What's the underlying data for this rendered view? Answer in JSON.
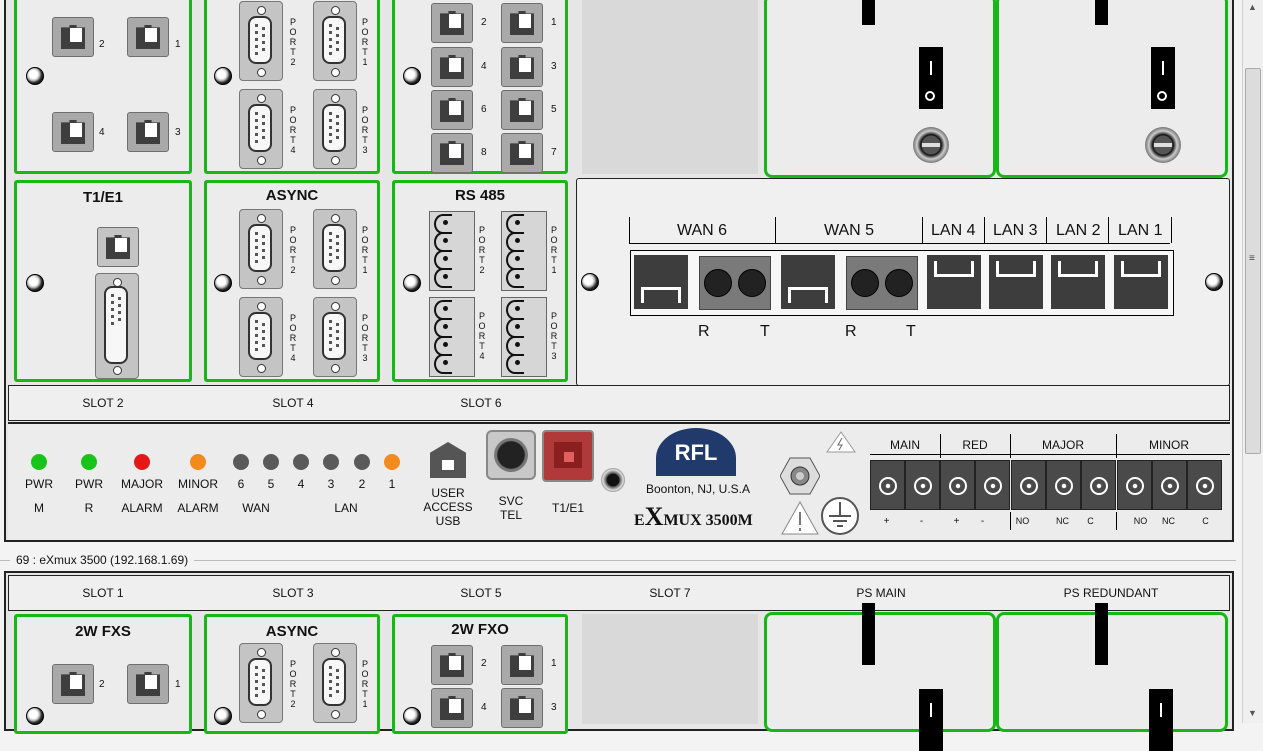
{
  "top_unit": {
    "slot1_ports": [
      "2",
      "1",
      "4",
      "3"
    ],
    "slot3_ports": [
      "PORT2",
      "PORT1",
      "PORT4",
      "PORT3"
    ],
    "slot5_ports": [
      "2",
      "1",
      "4",
      "3",
      "6",
      "5",
      "8",
      "7"
    ],
    "slot2_title": "T1/E1",
    "slot4_title": "ASYNC",
    "slot4_ports": [
      "PORT2",
      "PORT1",
      "PORT4",
      "PORT3"
    ],
    "slot6_title": "RS 485",
    "slot6_ports": [
      "PORT2",
      "PORT1",
      "PORT4",
      "PORT3"
    ],
    "wan_labels": [
      "WAN 6",
      "WAN 5",
      "LAN 4",
      "LAN 3",
      "LAN 2",
      "LAN 1"
    ],
    "rt_labels": [
      "R",
      "T",
      "R",
      "T"
    ],
    "slot_labels": [
      "SLOT 2",
      "SLOT 4",
      "SLOT 6"
    ],
    "front_panel": {
      "leds": [
        {
          "top": "PWR",
          "bottom": "M",
          "color": "#19c419"
        },
        {
          "top": "PWR",
          "bottom": "R",
          "color": "#19c419"
        },
        {
          "top": "MAJOR",
          "bottom": "ALARM",
          "color": "#e51818"
        },
        {
          "top": "MINOR",
          "bottom": "ALARM",
          "color": "#f28a1c"
        }
      ],
      "port_leds": [
        {
          "num": "6",
          "color": "#5a5a5a"
        },
        {
          "num": "5",
          "color": "#5a5a5a"
        },
        {
          "num": "4",
          "color": "#5a5a5a"
        },
        {
          "num": "3",
          "color": "#5a5a5a"
        },
        {
          "num": "2",
          "color": "#5a5a5a"
        },
        {
          "num": "1",
          "color": "#f28a1c"
        }
      ],
      "wan_label": "WAN",
      "lan_label": "LAN",
      "usb_label_1": "USER",
      "usb_label_2": "ACCESS",
      "usb_label_3": "USB",
      "svc_label_1": "SVC",
      "svc_label_2": "TEL",
      "t1e1_label": "T1/E1",
      "logo": "RFL",
      "location": "Boonton, NJ, U.S.A",
      "model_prefix": "E",
      "model_x": "X",
      "model_suffix": "MUX 3500M",
      "relay_groups": [
        "MAIN",
        "RED",
        "MAJOR",
        "MINOR"
      ],
      "relay_terms": [
        "+",
        "-",
        "+",
        "-",
        "NO",
        "NC",
        "C",
        "NO",
        "NC",
        "C"
      ]
    }
  },
  "device_header": "69 : eXmux 3500 (192.168.1.69)",
  "bottom_unit": {
    "slot_labels": [
      "SLOT 1",
      "SLOT 3",
      "SLOT 5",
      "SLOT 7",
      "PS MAIN",
      "PS REDUNDANT"
    ],
    "slot1_title": "2W FXS",
    "slot1_ports": [
      "2",
      "1"
    ],
    "slot3_title": "ASYNC",
    "slot3_ports": [
      "PORT2",
      "PORT1"
    ],
    "slot5_title": "2W FXO",
    "slot5_ports": [
      "2",
      "1",
      "4",
      "3"
    ]
  },
  "scrollbar": {
    "grip": "≡",
    "up": "▲",
    "down": "▼"
  }
}
